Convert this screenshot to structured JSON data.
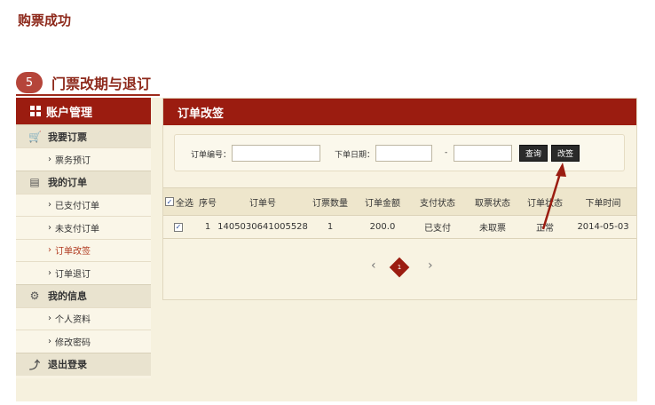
{
  "top_title": "购票成功",
  "step": {
    "number": "5",
    "label": "门票改期与退订"
  },
  "sidebar": {
    "header": "账户管理",
    "groups": [
      {
        "label": "我要订票",
        "icon": "cart-icon",
        "items": [
          "票务预订"
        ]
      },
      {
        "label": "我的订单",
        "icon": "document-icon",
        "items": [
          "已支付订单",
          "未支付订单",
          "订单改签",
          "订单退订"
        ]
      },
      {
        "label": "我的信息",
        "icon": "gear-icon",
        "items": [
          "个人资料",
          "修改密码"
        ]
      },
      {
        "label": "退出登录",
        "icon": "logout-icon",
        "items": []
      }
    ]
  },
  "main": {
    "title": "订单改签",
    "search": {
      "order_no_label": "订单编号：",
      "order_no_value": "",
      "date_label": "下单日期：",
      "date_from": "",
      "date_sep": "-",
      "date_to": "",
      "query_button": "查询",
      "change_button": "改签"
    },
    "table": {
      "select_all": "全选",
      "headers": [
        "序号",
        "订单号",
        "订票数量",
        "订单金额",
        "支付状态",
        "取票状态",
        "订单状态",
        "下单时间"
      ],
      "rows": [
        {
          "seq": "1",
          "order_no": "1405030641005528",
          "quantity": "1",
          "amount": "200.0",
          "pay_status": "已支付",
          "ticket_status": "未取票",
          "order_status": "正常",
          "time": "2014-05-03"
        }
      ]
    },
    "pager": {
      "prev": "‹",
      "current": "1",
      "next": "›"
    }
  },
  "colors": {
    "brand": "#9b1c10",
    "panel": "#f8f3e2",
    "arrow": "#9b1c10"
  }
}
